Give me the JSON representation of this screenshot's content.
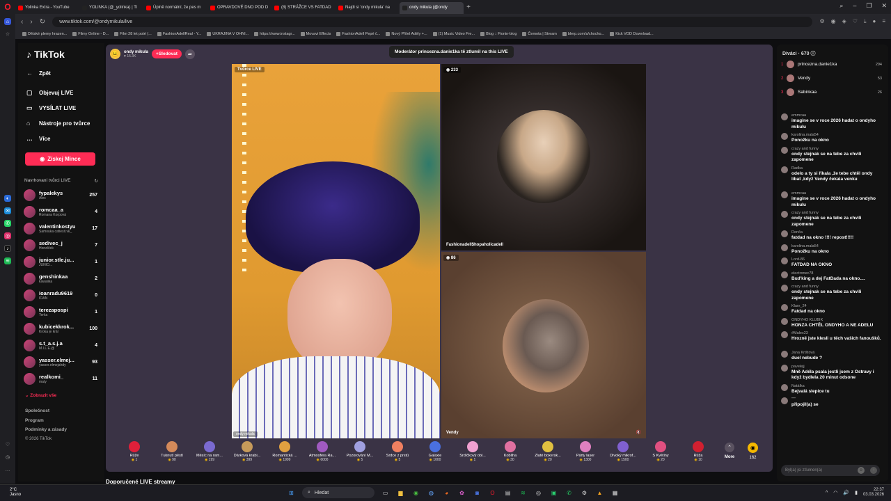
{
  "browser": {
    "tabs": [
      {
        "label": "Yolinka Extra - YouTube",
        "color": "#ff0000"
      },
      {
        "label": "YOLINKA (@_yolinka) | Ti",
        "color": "#222222"
      },
      {
        "label": "Úplně normální, že pes m",
        "color": "#ff0000"
      },
      {
        "label": "OPRAVDOVÉ DNO POD D",
        "color": "#ff0000"
      },
      {
        "label": "(8) STRÁŽCE VS FATDAD",
        "color": "#ff0000"
      },
      {
        "label": "Najdi si 'ondy mikula' na",
        "color": "#ff0000"
      },
      {
        "label": "ondy mikula (@ondy",
        "color": "#222222",
        "active": true
      }
    ],
    "url": "www.tiktok.com/@ondymikula/live",
    "bookmarks": [
      "Dětské plemy hrazen...",
      "Filmy Online - D...",
      "Film 28 let poté (...",
      "FashionAdellReal - Y...",
      "UKRAJINA V OHNI...",
      "https://www.instagr...",
      "Movavi Effects",
      "FashionAdell Pepé č...",
      "Nový Přítel Adély +...",
      "(1) Music Video Fre...",
      "Blog :: Fionin-blog",
      "Čemota | Stream",
      "blerp.com/s/chocho...",
      "Kick VOD Download..."
    ]
  },
  "nav": {
    "logo": "TikTok",
    "back": "Zpět",
    "items": [
      {
        "label": "Objevuj LIVE",
        "icon": "live-explore-icon"
      },
      {
        "label": "VYSÍLAT LIVE",
        "icon": "broadcast-icon"
      },
      {
        "label": "Nástroje pro tvůrce",
        "icon": "creator-tools-icon"
      },
      {
        "label": "Více",
        "icon": "more-icon"
      }
    ],
    "coins_button": "Získej Mince",
    "suggested_title": "Navrhovaní tvůrci LIVE",
    "creators": [
      {
        "name": "fypalekys",
        "sub": "Alex",
        "count": "257"
      },
      {
        "name": "romcaa_a",
        "sub": "Romana Korpová",
        "count": "4"
      },
      {
        "name": "valentinkostyu",
        "sub": "Samouka cafiesit.vk_",
        "count": "17"
      },
      {
        "name": "sedivec_j",
        "sub": "Honzíček",
        "count": "7"
      },
      {
        "name": "junior.stle.ju...",
        "sub": "JUNIO...",
        "count": "1"
      },
      {
        "name": "genshinkaa",
        "sub": "kawaiika",
        "count": "2"
      },
      {
        "name": "ioanradu9619",
        "sub": "IOAN",
        "count": "0"
      },
      {
        "name": "terezapospi",
        "sub": "Terka",
        "count": "1"
      },
      {
        "name": "kubicekkrok...",
        "sub": "Kroka je král",
        "count": "100"
      },
      {
        "name": "s.t_a.s.j.a",
        "sub": "M.I.L.E.@",
        "count": "4"
      },
      {
        "name": "yasser.elmej...",
        "sub": "yasser.elmejahdy",
        "count": "93"
      },
      {
        "name": "realkomi_",
        "sub": "maty",
        "count": "11"
      }
    ],
    "show_all": "Zobrazit vše",
    "footer": [
      "Společnost",
      "Program",
      "Podmínky a zásady",
      "© 2026 TikTok"
    ]
  },
  "stream": {
    "host_name": "ondy mikula",
    "host_viewers": "15.3K",
    "follow": "Sledovat",
    "toast": "Moderátor princezna.danie1ka tě ztlumil na this LIVE",
    "main_tag": "Tvůrce LIVE",
    "main_name": "ondy mikula",
    "top_right": {
      "count": "233",
      "name": "Fashionadell$hopaholicadell"
    },
    "bottom_right": {
      "count": "86",
      "name": "Vendy"
    },
    "recommended": "Doporučené LIVE streamy"
  },
  "gifts": [
    {
      "name": "Růže",
      "price": "1",
      "color": "#e0203a"
    },
    {
      "name": "Ťuknutí pěstí",
      "price": "90",
      "color": "#d48a5a"
    },
    {
      "name": "Měsíc na ram...",
      "price": "199",
      "color": "#7a6ad0"
    },
    {
      "name": "Dárková krabi...",
      "price": "399",
      "color": "#c69a5a"
    },
    {
      "name": "Romantická ...",
      "price": "1999",
      "color": "#e0a040"
    },
    {
      "name": "Atmosféra Ra...",
      "price": "6000",
      "color": "#a05ac0"
    },
    {
      "name": "Pozorování M...",
      "price": "5",
      "color": "#a0a0e0"
    },
    {
      "name": "Srdce z prstů",
      "price": "5",
      "color": "#f08060"
    },
    {
      "name": "Galaxie",
      "price": "1000",
      "color": "#4a70e0"
    },
    {
      "name": "Srdíčkový obl...",
      "price": "1",
      "color": "#f0a0d0"
    },
    {
      "name": "Kobliha",
      "price": "30",
      "color": "#e070a0"
    },
    {
      "name": "Zlaté boxersk...",
      "price": "20",
      "color": "#e0c040"
    },
    {
      "name": "Párty laser",
      "price": "1300",
      "color": "#e080c0"
    },
    {
      "name": "Divoký mikrof...",
      "price": "1500",
      "color": "#8060d0"
    },
    {
      "name": "S Květiny",
      "price": "20",
      "color": "#e05080"
    },
    {
      "name": "Růža",
      "price": "10",
      "color": "#d02030"
    }
  ],
  "gift_more": "More",
  "coin_balance": "162",
  "viewers": {
    "title": "Diváci · 670",
    "top": [
      {
        "rank": "1",
        "name": "princezna.danie1ka",
        "score": "294"
      },
      {
        "rank": "2",
        "name": "Vendy",
        "score": "53"
      },
      {
        "rank": "3",
        "name": "Sabinkaa",
        "score": "26"
      }
    ]
  },
  "chat": [
    {
      "user": "emmcaa",
      "text": "imagine se v roce 2026 hadat o ondyho mikulu"
    },
    {
      "user": "karolina.mala54",
      "text": "Ponožku na okno"
    },
    {
      "user": "crazy and funny",
      "text": "ondy stejnak se na tebe za chvili zapomene"
    },
    {
      "user": "Radka",
      "text": "odelo a ty si říkala ,že tebe chtěl ondy líbat ,když Vendy čekala venku"
    },
    {
      "user": "emmcaa",
      "text": "imagine se v roce 2026 hadat o ondyho mikulu"
    },
    {
      "user": "crazy and funny",
      "text": "ondy stejnak se na tebe za chvili zapomene"
    },
    {
      "user": "Denča",
      "text": "fatdad na okno !!!! repost!!!!!"
    },
    {
      "user": "karolina.mala54",
      "text": "Ponožku na okno"
    },
    {
      "user": "Lord-86",
      "text": "FATDAD NA OKNO"
    },
    {
      "user": "electronec78",
      "text": "Bud'king a dej FatDada na okno...."
    },
    {
      "user": "crazy and funny",
      "text": "ondy stejnak se na tebe za chvili zapomene"
    },
    {
      "user": "Klarx_24",
      "text": "Fatdad na okno"
    },
    {
      "user": "ONDYHO KLUBIK",
      "text": "HONZA CHTĚL ONDYHO A NE ADELU"
    },
    {
      "user": "#Malec23",
      "text": "Hrozně jste klesli u těch vašich fanoušků."
    },
    {
      "user": "Jana Krištová",
      "text": "duel nebude ?"
    },
    {
      "user": "pavelejj",
      "text": "Mně Adéla psala jestli jsem z Ostravy i když bydlela 20 minut odsone"
    },
    {
      "user": "Natálka",
      "text": "Bejvalá slepice tu"
    },
    {
      "user": "\"\"\"",
      "text": "připojil(a) se"
    }
  ],
  "chat_placeholder": "Byl(a) jsi ztlumen(a)",
  "taskbar": {
    "weather_temp": "2°C",
    "weather_desc": "Jasno",
    "search": "Hledat",
    "time": "22:37",
    "date": "03.03.2026"
  }
}
